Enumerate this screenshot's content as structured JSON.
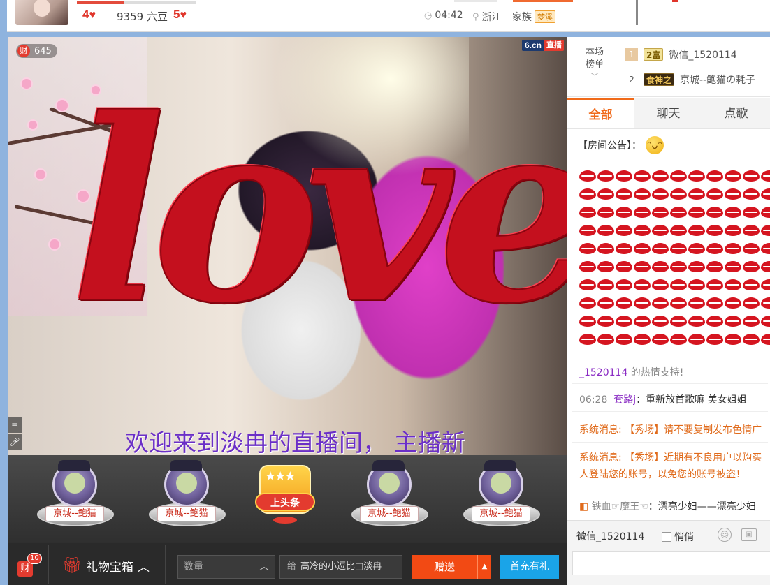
{
  "header": {
    "level_left": "4",
    "level_right": "5",
    "beans": "9359 六豆",
    "duration": "04:42",
    "location": "浙江",
    "family_label": "家族",
    "family_badge": "梦溪",
    "level_progress": 0.4
  },
  "video": {
    "coin_count": "645",
    "coin_label": "财",
    "brand": "6.cn",
    "live_tag": "直播",
    "overlay_text": "love",
    "welcome": "欢迎来到淡冉的直播间， 主播新"
  },
  "gifts": {
    "slot_label": "京城--鲍猫",
    "toutiao": "上头条"
  },
  "bottom": {
    "cai": "财",
    "cai_count": "10",
    "gift_box": "礼物宝箱",
    "quantity_placeholder": "数量",
    "to_label": "给",
    "to_user": "高冷的小逗比□淡冉",
    "send": "赠送",
    "recharge": "首充有礼"
  },
  "rank": {
    "title": "本场榜单",
    "rows": [
      {
        "no": "1",
        "badge": "2富",
        "name": "微信_1520114"
      },
      {
        "no": "2",
        "badge": "食神之",
        "name": "京城--鲍猫の耗子"
      }
    ]
  },
  "tabs": [
    "全部",
    "聊天",
    "点歌"
  ],
  "chat": {
    "notice_label": "【房间公告】：",
    "support_user": "_1520114",
    "support_text": " 的热情支持!",
    "msg1_time": "06:28",
    "msg1_user": "套路j",
    "msg1_text": "：重新放首歌嘛 美女姐姐",
    "sys1_label": "系统消息:",
    "sys1_text": "【秀场】请不要复制发布色情广",
    "sys2_label": "系统消息:",
    "sys2_text": "【秀场】近期有不良用户以购买",
    "sys2_text2": "人登陆您的账号，以免您的账号被盗！",
    "msg2_user": "铁血☞魔王☜",
    "msg2_text": "：漂亮少妇——漂亮少妇"
  },
  "chatbar": {
    "name": "微信_1520114",
    "quiet": "悄俏"
  },
  "colors": {
    "accent": "#f06a1a",
    "love_red": "#c4101e",
    "send_orange": "#f24a14",
    "recharge_blue": "#1aa4e8"
  }
}
